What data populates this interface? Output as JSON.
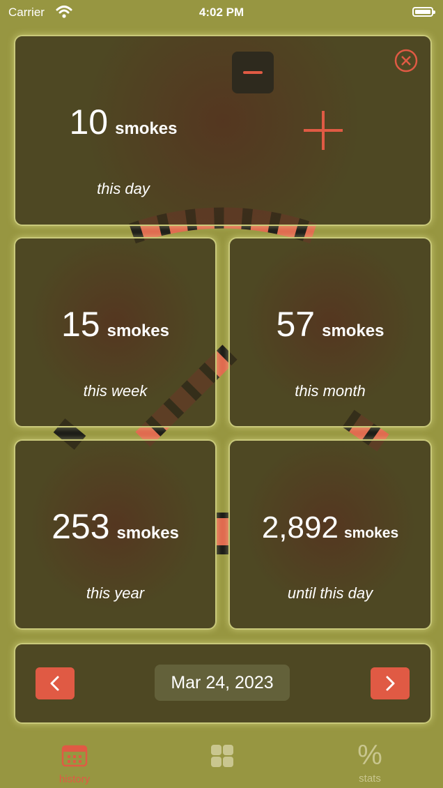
{
  "status_bar": {
    "carrier": "Carrier",
    "time": "4:02 PM"
  },
  "cards": {
    "day": {
      "value": "10",
      "unit": "smokes",
      "period": "this day"
    },
    "week": {
      "value": "15",
      "unit": "smokes",
      "period": "this week"
    },
    "month": {
      "value": "57",
      "unit": "smokes",
      "period": "this month"
    },
    "year": {
      "value": "253",
      "unit": "smokes",
      "period": "this year"
    },
    "total": {
      "value": "2,892",
      "unit": "smokes",
      "period": "until this day"
    }
  },
  "date_nav": {
    "date": "Mar 24, 2023"
  },
  "tabs": [
    {
      "label": "history",
      "icon": "calendar-icon",
      "active": true
    },
    {
      "label": "",
      "icon": "grid-icon",
      "active": false
    },
    {
      "label": "stats",
      "icon": "percent-icon",
      "active": false
    }
  ],
  "colors": {
    "background": "#979641",
    "accent": "#e05a44",
    "card": "#4a4322"
  }
}
